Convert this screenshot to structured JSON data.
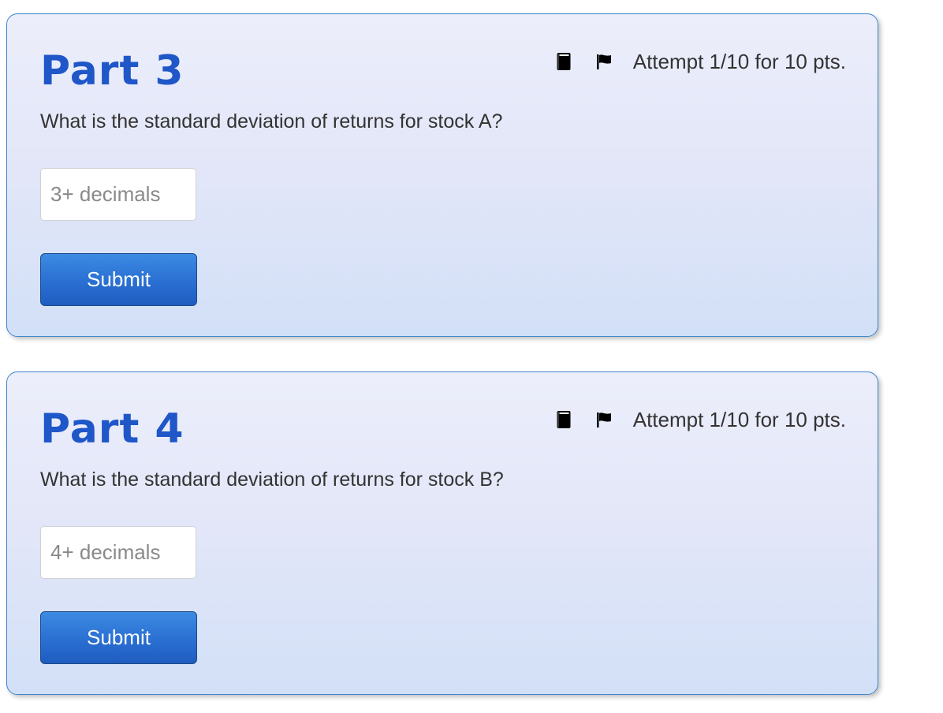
{
  "parts": [
    {
      "title": "Part 3",
      "question": "What is the standard deviation of returns for stock A?",
      "input_placeholder": "3+ decimals",
      "input_value": "",
      "submit_label": "Submit",
      "attempt_text": "Attempt 1/10 for 10 pts.",
      "icons": [
        "book-icon",
        "flag-icon"
      ]
    },
    {
      "title": "Part 4",
      "question": "What is the standard deviation of returns for stock B?",
      "input_placeholder": "4+ decimals",
      "input_value": "",
      "submit_label": "Submit",
      "attempt_text": "Attempt 1/10 for 10 pts.",
      "icons": [
        "book-icon",
        "flag-icon"
      ]
    }
  ],
  "colors": {
    "title": "#1f57c8",
    "card_border": "#3d86cc",
    "button": "#2a6fd2"
  }
}
